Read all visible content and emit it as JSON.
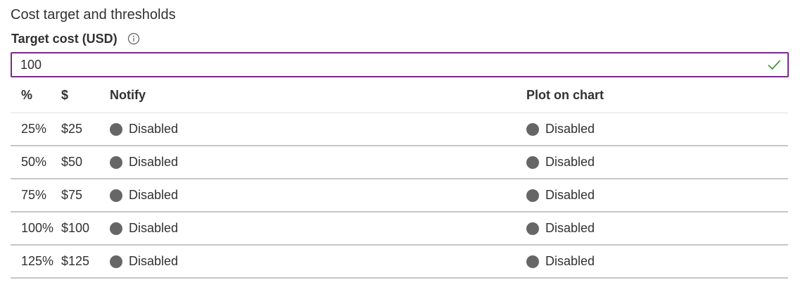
{
  "section": {
    "title": "Cost target and thresholds"
  },
  "target": {
    "label": "Target cost (USD)",
    "info_icon": "info-icon",
    "value": "100",
    "valid_icon": "checkmark-icon",
    "border_color": "#7b2a8b",
    "check_color": "#3d9b35"
  },
  "table": {
    "headers": {
      "pct": "%",
      "usd": "$",
      "notify": "Notify",
      "plot": "Plot on chart"
    },
    "rows": [
      {
        "pct": "25%",
        "usd": "$25",
        "notify": "Disabled",
        "plot": "Disabled"
      },
      {
        "pct": "50%",
        "usd": "$50",
        "notify": "Disabled",
        "plot": "Disabled"
      },
      {
        "pct": "75%",
        "usd": "$75",
        "notify": "Disabled",
        "plot": "Disabled"
      },
      {
        "pct": "100%",
        "usd": "$100",
        "notify": "Disabled",
        "plot": "Disabled"
      },
      {
        "pct": "125%",
        "usd": "$125",
        "notify": "Disabled",
        "plot": "Disabled"
      }
    ],
    "toggle_color": "#666666"
  }
}
